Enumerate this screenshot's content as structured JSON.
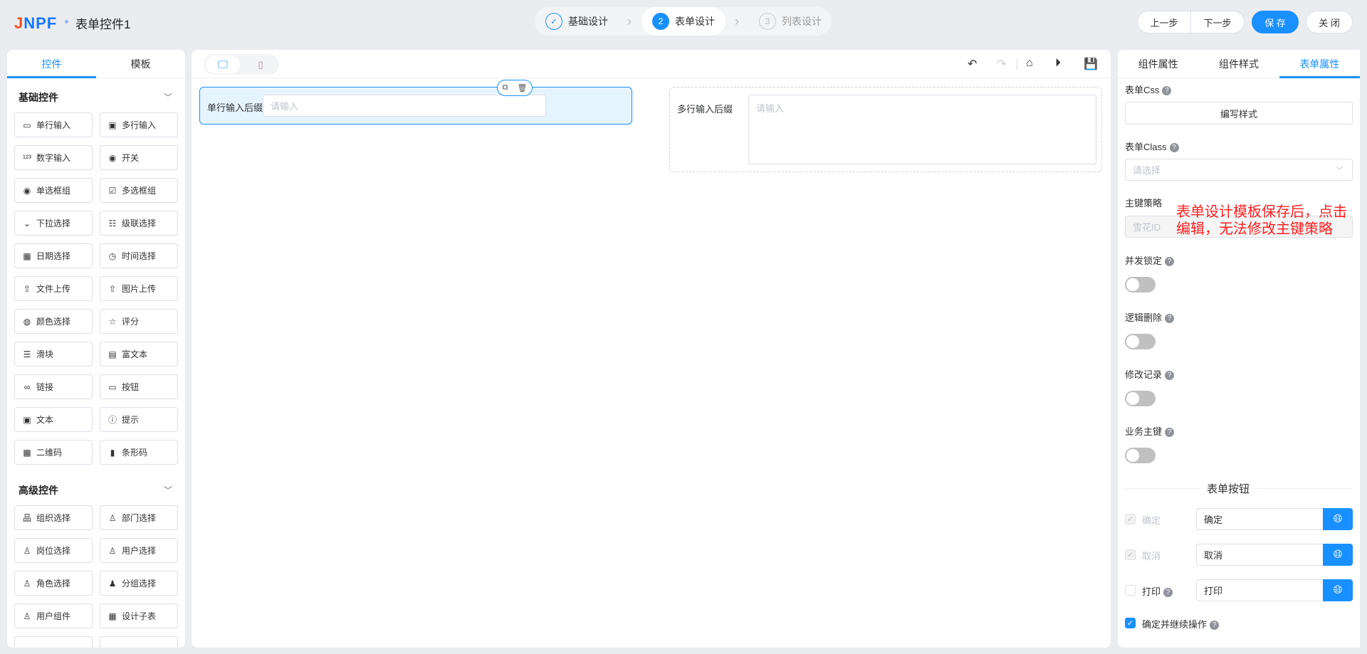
{
  "header": {
    "logo": "JNPF",
    "title": "表单控件1",
    "steps": [
      {
        "num": "1",
        "label": "基础设计",
        "state": "done"
      },
      {
        "num": "2",
        "label": "表单设计",
        "state": "active"
      },
      {
        "num": "3",
        "label": "列表设计",
        "state": "pending"
      }
    ],
    "prev": "上一步",
    "next": "下一步",
    "save": "保 存",
    "close": "关 闭"
  },
  "colors": {
    "accent": "#1890ff",
    "annotation": "#ff1f1f"
  },
  "left": {
    "tabs": [
      "控件",
      "模板"
    ],
    "basic_title": "基础控件",
    "basic": [
      [
        "单行输入",
        "input-icon"
      ],
      [
        "多行输入",
        "textarea-icon"
      ],
      [
        "数字输入",
        "number-icon"
      ],
      [
        "开关",
        "switch-icon"
      ],
      [
        "单选框组",
        "radio-icon"
      ],
      [
        "多选框组",
        "checkbox-icon"
      ],
      [
        "下拉选择",
        "select-icon"
      ],
      [
        "级联选择",
        "cascader-icon"
      ],
      [
        "日期选择",
        "calendar-icon"
      ],
      [
        "时间选择",
        "clock-icon"
      ],
      [
        "文件上传",
        "upload-icon"
      ],
      [
        "图片上传",
        "image-upload-icon"
      ],
      [
        "颜色选择",
        "palette-icon"
      ],
      [
        "评分",
        "star-icon"
      ],
      [
        "滑块",
        "slider-icon"
      ],
      [
        "富文本",
        "richtext-icon"
      ],
      [
        "链接",
        "link-icon"
      ],
      [
        "按钮",
        "button-icon"
      ],
      [
        "文本",
        "text-icon"
      ],
      [
        "提示",
        "alert-icon"
      ],
      [
        "二维码",
        "qrcode-icon"
      ],
      [
        "条形码",
        "barcode-icon"
      ]
    ],
    "advanced_title": "高级控件",
    "advanced": [
      [
        "组织选择",
        "org-icon"
      ],
      [
        "部门选择",
        "dept-icon"
      ],
      [
        "岗位选择",
        "position-icon"
      ],
      [
        "用户选择",
        "user-icon"
      ],
      [
        "角色选择",
        "role-icon"
      ],
      [
        "分组选择",
        "group-icon"
      ],
      [
        "用户组件",
        "user-add-icon"
      ],
      [
        "设计子表",
        "table-icon"
      ],
      [
        "",
        ""
      ],
      [
        "",
        ""
      ]
    ]
  },
  "canvas": {
    "field1": {
      "label": "单行输入后缀",
      "placeholder": "请输入"
    },
    "field2": {
      "label": "多行输入后缀",
      "placeholder": "请输入"
    }
  },
  "right": {
    "tabs": [
      "组件属性",
      "组件样式",
      "表单属性"
    ],
    "css_label": "表单Css",
    "css_button": "编写样式",
    "class_label": "表单Class",
    "class_placeholder": "请选择",
    "pk_label": "主键策略",
    "pk_value": "雪花ID",
    "annotation": "表单设计模板保存后，点击编辑，无法修改主键策略",
    "toggles": [
      {
        "label": "并发锁定",
        "on": false
      },
      {
        "label": "逻辑删除",
        "on": false
      },
      {
        "label": "修改记录",
        "on": false
      },
      {
        "label": "业务主键",
        "on": false
      }
    ],
    "buttons_title": "表单按钮",
    "buttons": [
      {
        "label": "确定",
        "value": "确定",
        "checked": true,
        "disabled": true
      },
      {
        "label": "取消",
        "value": "取消",
        "checked": true,
        "disabled": true
      },
      {
        "label": "打印",
        "value": "打印",
        "checked": false,
        "disabled": false
      }
    ],
    "continue_label": "确定并继续操作",
    "continue_checked": true
  }
}
